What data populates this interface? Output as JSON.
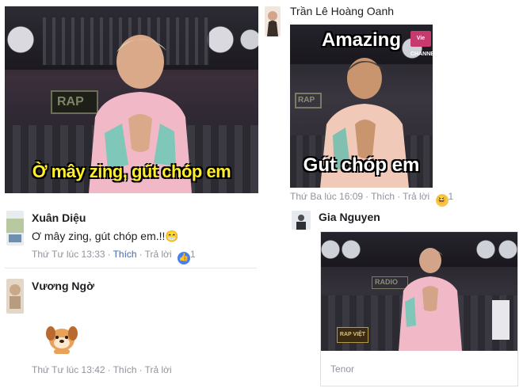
{
  "left": {
    "meme_caption": "Ờ mây zing, gút chóp em",
    "meme_badge": "RAP",
    "comments": [
      {
        "author": "Xuân Diệu",
        "text": "Ơ mây zing, gút chóp em.!!",
        "text_emoji": "😁",
        "timestamp": "Thứ Tư lúc 13:33",
        "like_label": "Thích",
        "reply_label": "Trả lời",
        "reaction": "like",
        "reaction_count": "1"
      },
      {
        "author": "Vương Ngờ",
        "sticker": "dog-sticker",
        "timestamp": "Thứ Tư lúc 13:42",
        "like_label": "Thích",
        "reply_label": "Trả lời"
      }
    ]
  },
  "right": {
    "post_author": "Trần Lê Hoàng Oanh",
    "meme_top_caption": "Amazing",
    "meme_bottom_caption": "Gút chóp em",
    "meme_badge": "RAP",
    "meme_channel": "Vie CHANNEL",
    "timestamp": "Thứ Ba lúc 16:09",
    "like_label": "Thích",
    "reply_label": "Trả lời",
    "reaction": "haha",
    "reaction_count": "1",
    "reply": {
      "author": "Gia Nguyen",
      "gif_badge": "RADIO",
      "gif_logo": "RAP VIỆT",
      "gif_source": "Tenor"
    }
  },
  "colors": {
    "caption_yellow": "#ffef2a",
    "link_blue": "#4267b2",
    "meta_gray": "#90949c"
  }
}
